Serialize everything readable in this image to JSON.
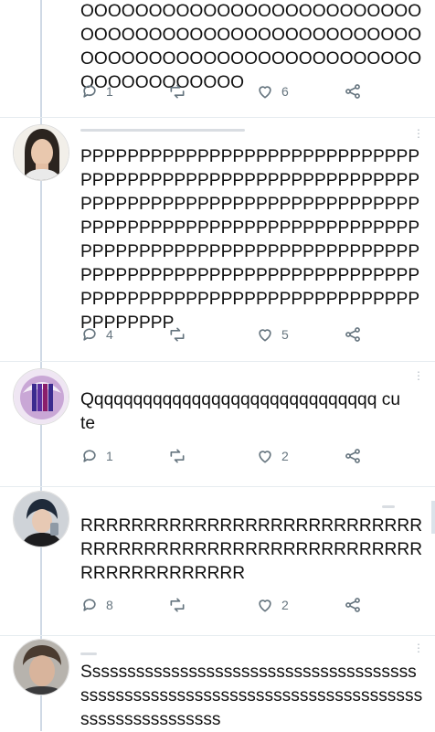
{
  "posts": [
    {
      "text": "OOOOOOOOOOOOOOOOOOOOOOOOOOOOOOOOOOOOOOOOOOOOOOOOOOOOOOOOOOOOOOOOOOOOOOOOOOOOOOOOOOOOOOO",
      "replies": "1",
      "likes": "6",
      "avatar_icon": "none"
    },
    {
      "text": "PPPPPPPPPPPPPPPPPPPPPPPPPPPPPPPPPPPPPPPPPPPPPPPPPPPPPPPPPPPPPPPPPPPPPPPPPPPPPPPPPPPPPPPPPPPPPPPPPPPPPPPPPPPPPPPPPPPPPPPPPPPPPPPPPPPPPPPPPPPPPPPPPPPPPPPPPPPPPPPPPPPPPPPPPPPPPPPPPPPPPPPPPPPPPPPPPPPPPPPPPPPPPPPPPPP",
      "replies": "4",
      "likes": "5",
      "avatar_icon": "woman-portrait-avatar"
    },
    {
      "text": "Qqqqqqqqqqqqqqqqqqqqqqqqqqqqqq cute",
      "replies": "1",
      "likes": "2",
      "avatar_icon": "purple-logo-avatar"
    },
    {
      "text": "RRRRRRRRRRRRRRRRRRRRRRRRRRRRRRRRRRRRRRRRRRRRRRRRRRRRRRRRRRRRRRRRRRR",
      "replies": "8",
      "likes": "2",
      "avatar_icon": "man-portrait-avatar"
    },
    {
      "text": "Sssssssssssssssssssssssssssssssssssssssssssssssssssssssssssssssssssssssssssssssssssssssssssss",
      "replies": "",
      "likes": "",
      "avatar_icon": "man-closeup-avatar"
    }
  ],
  "colors": {
    "text": "#111111",
    "meta": "#66757f",
    "divider": "#e6ecf0",
    "thread_line": "#cfd9e5"
  }
}
